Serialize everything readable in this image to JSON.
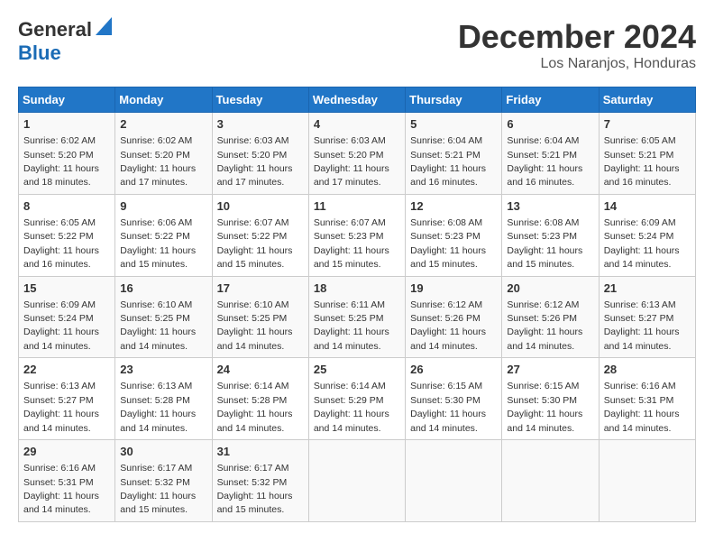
{
  "logo": {
    "general": "General",
    "blue": "Blue"
  },
  "title": "December 2024",
  "subtitle": "Los Naranjos, Honduras",
  "headers": [
    "Sunday",
    "Monday",
    "Tuesday",
    "Wednesday",
    "Thursday",
    "Friday",
    "Saturday"
  ],
  "weeks": [
    [
      {
        "day": "1",
        "sunrise": "6:02 AM",
        "sunset": "5:20 PM",
        "daylight": "11 hours and 18 minutes."
      },
      {
        "day": "2",
        "sunrise": "6:02 AM",
        "sunset": "5:20 PM",
        "daylight": "11 hours and 17 minutes."
      },
      {
        "day": "3",
        "sunrise": "6:03 AM",
        "sunset": "5:20 PM",
        "daylight": "11 hours and 17 minutes."
      },
      {
        "day": "4",
        "sunrise": "6:03 AM",
        "sunset": "5:20 PM",
        "daylight": "11 hours and 17 minutes."
      },
      {
        "day": "5",
        "sunrise": "6:04 AM",
        "sunset": "5:21 PM",
        "daylight": "11 hours and 16 minutes."
      },
      {
        "day": "6",
        "sunrise": "6:04 AM",
        "sunset": "5:21 PM",
        "daylight": "11 hours and 16 minutes."
      },
      {
        "day": "7",
        "sunrise": "6:05 AM",
        "sunset": "5:21 PM",
        "daylight": "11 hours and 16 minutes."
      }
    ],
    [
      {
        "day": "8",
        "sunrise": "6:05 AM",
        "sunset": "5:22 PM",
        "daylight": "11 hours and 16 minutes."
      },
      {
        "day": "9",
        "sunrise": "6:06 AM",
        "sunset": "5:22 PM",
        "daylight": "11 hours and 15 minutes."
      },
      {
        "day": "10",
        "sunrise": "6:07 AM",
        "sunset": "5:22 PM",
        "daylight": "11 hours and 15 minutes."
      },
      {
        "day": "11",
        "sunrise": "6:07 AM",
        "sunset": "5:23 PM",
        "daylight": "11 hours and 15 minutes."
      },
      {
        "day": "12",
        "sunrise": "6:08 AM",
        "sunset": "5:23 PM",
        "daylight": "11 hours and 15 minutes."
      },
      {
        "day": "13",
        "sunrise": "6:08 AM",
        "sunset": "5:23 PM",
        "daylight": "11 hours and 15 minutes."
      },
      {
        "day": "14",
        "sunrise": "6:09 AM",
        "sunset": "5:24 PM",
        "daylight": "11 hours and 14 minutes."
      }
    ],
    [
      {
        "day": "15",
        "sunrise": "6:09 AM",
        "sunset": "5:24 PM",
        "daylight": "11 hours and 14 minutes."
      },
      {
        "day": "16",
        "sunrise": "6:10 AM",
        "sunset": "5:25 PM",
        "daylight": "11 hours and 14 minutes."
      },
      {
        "day": "17",
        "sunrise": "6:10 AM",
        "sunset": "5:25 PM",
        "daylight": "11 hours and 14 minutes."
      },
      {
        "day": "18",
        "sunrise": "6:11 AM",
        "sunset": "5:25 PM",
        "daylight": "11 hours and 14 minutes."
      },
      {
        "day": "19",
        "sunrise": "6:12 AM",
        "sunset": "5:26 PM",
        "daylight": "11 hours and 14 minutes."
      },
      {
        "day": "20",
        "sunrise": "6:12 AM",
        "sunset": "5:26 PM",
        "daylight": "11 hours and 14 minutes."
      },
      {
        "day": "21",
        "sunrise": "6:13 AM",
        "sunset": "5:27 PM",
        "daylight": "11 hours and 14 minutes."
      }
    ],
    [
      {
        "day": "22",
        "sunrise": "6:13 AM",
        "sunset": "5:27 PM",
        "daylight": "11 hours and 14 minutes."
      },
      {
        "day": "23",
        "sunrise": "6:13 AM",
        "sunset": "5:28 PM",
        "daylight": "11 hours and 14 minutes."
      },
      {
        "day": "24",
        "sunrise": "6:14 AM",
        "sunset": "5:28 PM",
        "daylight": "11 hours and 14 minutes."
      },
      {
        "day": "25",
        "sunrise": "6:14 AM",
        "sunset": "5:29 PM",
        "daylight": "11 hours and 14 minutes."
      },
      {
        "day": "26",
        "sunrise": "6:15 AM",
        "sunset": "5:30 PM",
        "daylight": "11 hours and 14 minutes."
      },
      {
        "day": "27",
        "sunrise": "6:15 AM",
        "sunset": "5:30 PM",
        "daylight": "11 hours and 14 minutes."
      },
      {
        "day": "28",
        "sunrise": "6:16 AM",
        "sunset": "5:31 PM",
        "daylight": "11 hours and 14 minutes."
      }
    ],
    [
      {
        "day": "29",
        "sunrise": "6:16 AM",
        "sunset": "5:31 PM",
        "daylight": "11 hours and 14 minutes."
      },
      {
        "day": "30",
        "sunrise": "6:17 AM",
        "sunset": "5:32 PM",
        "daylight": "11 hours and 15 minutes."
      },
      {
        "day": "31",
        "sunrise": "6:17 AM",
        "sunset": "5:32 PM",
        "daylight": "11 hours and 15 minutes."
      },
      null,
      null,
      null,
      null
    ]
  ]
}
